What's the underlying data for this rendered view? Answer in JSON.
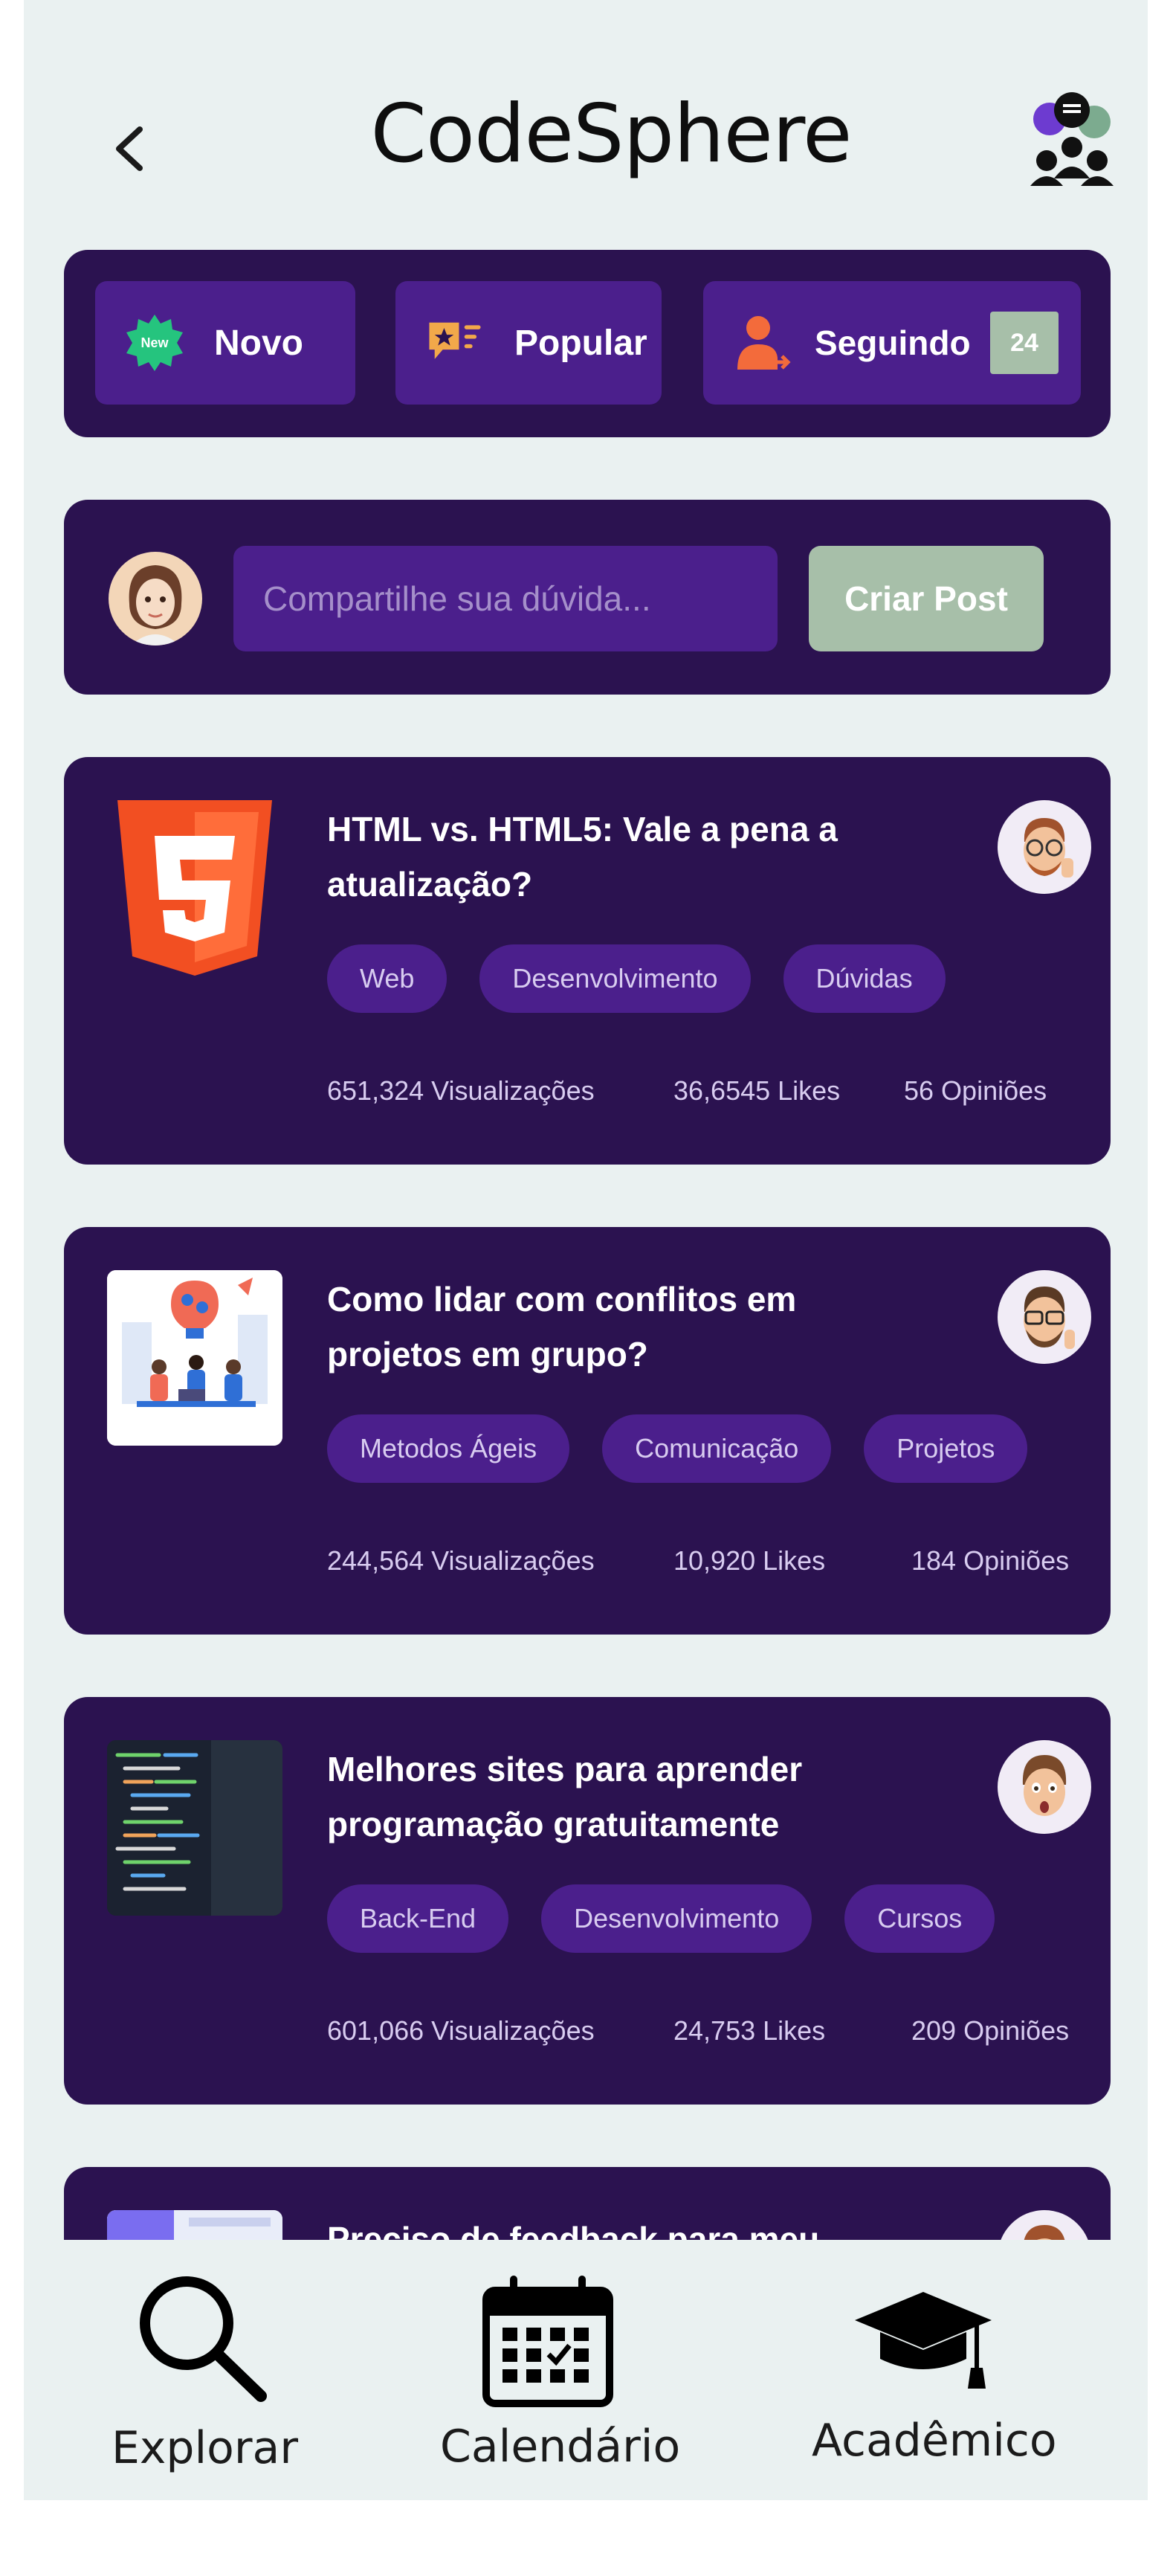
{
  "header": {
    "title": "CodeSphere"
  },
  "filters": [
    {
      "label": "Novo",
      "icon": "new-badge-icon",
      "badge_text": "New"
    },
    {
      "label": "Popular",
      "icon": "featured-post-icon"
    },
    {
      "label": "Seguindo",
      "icon": "follow-user-icon",
      "count": "24"
    }
  ],
  "composer": {
    "placeholder": "Compartilhe sua dúvida...",
    "create_label": "Criar Post"
  },
  "posts": [
    {
      "title_line1": "HTML vs. HTML5: Vale a pena a",
      "title_line2": "atualização?",
      "tags": [
        "Web",
        "Desenvolvimento",
        "Dúvidas"
      ],
      "views": "651,324 Visualizações",
      "likes": "36,6545 Likes",
      "opinions": "56 Opiniões",
      "thumb": "html5-logo"
    },
    {
      "title_line1": "Como lidar com conflitos em",
      "title_line2": "projetos em grupo?",
      "tags": [
        "Metodos Ágeis",
        "Comunicação",
        "Projetos"
      ],
      "views": "244,564 Visualizações",
      "likes": "10,920 Likes",
      "opinions": "184 Opiniões",
      "thumb": "team-illustration"
    },
    {
      "title_line1": "Melhores sites para aprender",
      "title_line2": "programação gratuitamente",
      "tags": [
        "Back-End",
        "Desenvolvimento",
        "Cursos"
      ],
      "views": "601,066 Visualizações",
      "likes": "24,753 Likes",
      "opinions": "209 Opiniões",
      "thumb": "code-screen"
    },
    {
      "title_line1": "Preciso de feedback para meu",
      "thumb": "web-layout"
    }
  ],
  "bottom_nav": [
    {
      "label": "Explorar",
      "icon": "search-icon"
    },
    {
      "label": "Calendário",
      "icon": "calendar-icon"
    },
    {
      "label": "Acadêmico",
      "icon": "graduation-cap-icon"
    }
  ],
  "colors": {
    "background": "#eaf1f1",
    "card": "#2b1250",
    "chip": "#4b1f8c",
    "accent_green": "#a7bfa9",
    "orange": "#f36b3b"
  }
}
